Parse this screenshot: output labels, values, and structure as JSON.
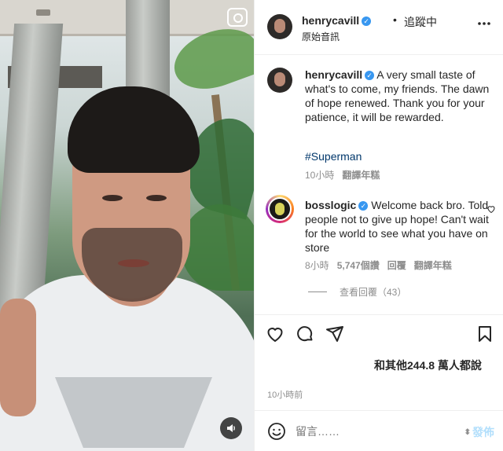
{
  "header": {
    "username": "henrycavill",
    "separator": "•",
    "follow_status": "追蹤中",
    "subtitle": "原始音訊",
    "more_icon": "more-horizontal-icon"
  },
  "caption": {
    "username": "henrycavill",
    "text": "A very small taste of what's to come, my friends. The dawn of hope renewed. Thank you for your patience, it will be rewarded.",
    "hashtag": "#Superman",
    "time": "10小時",
    "translate": "翻譯年糕"
  },
  "comment": {
    "username": "bosslogic",
    "text": "Welcome back bro. Told people not to give up hope! Can't wait for the world to see what you have on store",
    "time": "8小時",
    "likes": "5,747個讚",
    "reply": "回覆",
    "translate": "翻譯年糕",
    "view_replies": "查看回覆（43）"
  },
  "actions": {
    "like_icon": "heart-icon",
    "comment_icon": "comment-icon",
    "share_icon": "send-icon",
    "save_icon": "bookmark-icon"
  },
  "likes_text": "和其他244.8 萬人都說",
  "post_time": "10小時前",
  "composer": {
    "placeholder": "留言……",
    "post_label": "發佈"
  },
  "colors": {
    "link": "#00376b",
    "verified": "#3897f0",
    "post_disabled": "#b2dffc",
    "muted": "#8e8e8e"
  }
}
